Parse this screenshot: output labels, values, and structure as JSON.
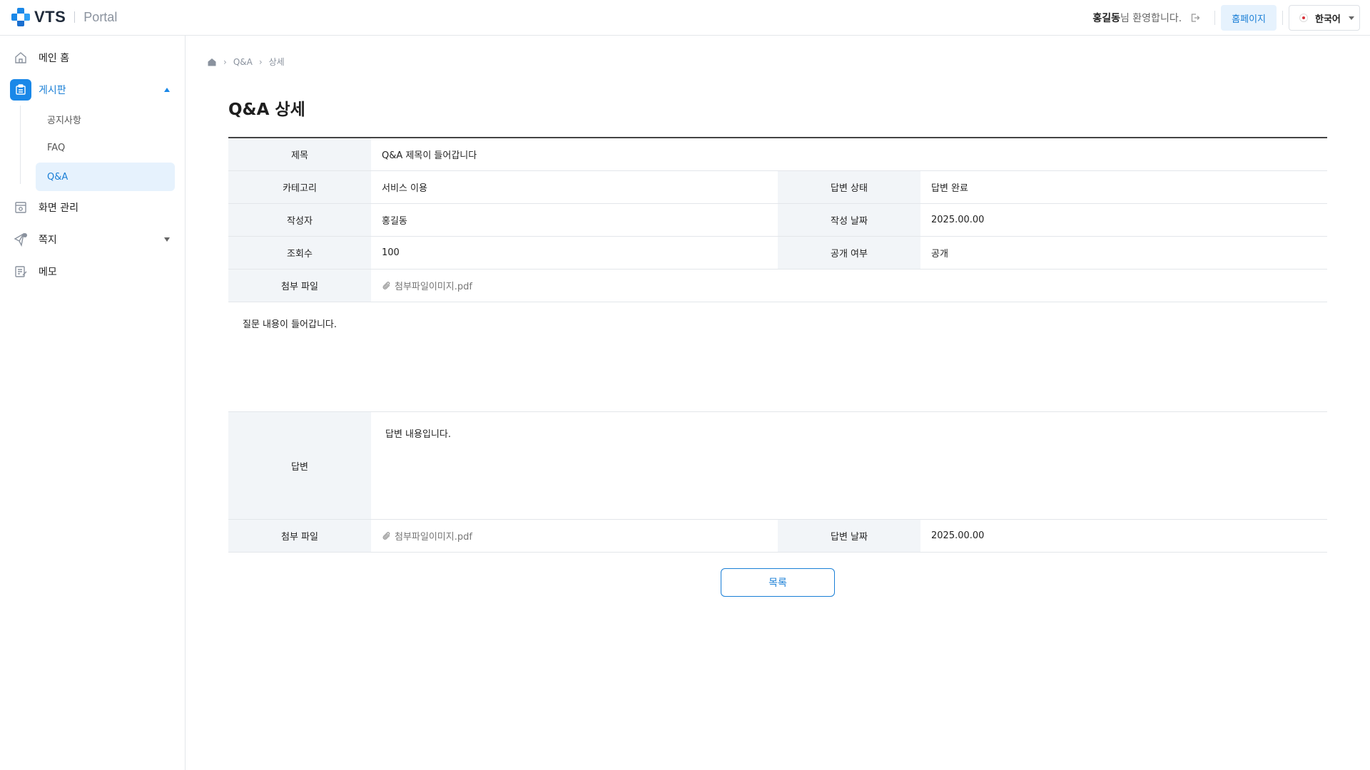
{
  "header": {
    "brand": "VTS",
    "portal": "Portal",
    "user_name": "홍길동",
    "welcome_suffix": "님 환영합니다.",
    "home_button": "홈페이지",
    "language": "한국어"
  },
  "sidebar": {
    "items": [
      {
        "label": "메인 홈",
        "icon": "home-icon"
      },
      {
        "label": "게시판",
        "icon": "board-icon"
      },
      {
        "label": "화면 관리",
        "icon": "screen-icon"
      },
      {
        "label": "쪽지",
        "icon": "message-icon"
      },
      {
        "label": "메모",
        "icon": "memo-icon"
      }
    ],
    "sub_items": [
      {
        "label": "공지사항"
      },
      {
        "label": "FAQ"
      },
      {
        "label": "Q&A"
      }
    ]
  },
  "breadcrumb": {
    "items": [
      "Q&A",
      "상세"
    ]
  },
  "page_title": "Q&A 상세",
  "detail": {
    "title_label": "제목",
    "title_value": "Q&A 제목이 들어갑니다",
    "category_label": "카테고리",
    "category_value": "서비스 이용",
    "answer_status_label": "답변 상태",
    "answer_status_value": "답변 완료",
    "author_label": "작성자",
    "author_value": "홍길동",
    "created_label": "작성 날짜",
    "created_value": "2025.00.00",
    "views_label": "조회수",
    "views_value": "100",
    "public_label": "공개 여부",
    "public_value": "공개",
    "attachment_label": "첨부 파일",
    "attachment_value": "첨부파일이미지.pdf",
    "question_body": "질문 내용이 들어갑니다.",
    "answer_label": "답변",
    "answer_body": "답변 내용입니다.",
    "answer_attachment_label": "첨부 파일",
    "answer_attachment_value": "첨부파일이미지.pdf",
    "answer_date_label": "답변 날짜",
    "answer_date_value": "2025.00.00"
  },
  "list_button": "목록",
  "colors": {
    "accent": "#1a88e8",
    "accent_text": "#1a7fd6",
    "accent_bg": "#e6f2fd",
    "header_cell_bg": "#f2f5f8"
  }
}
